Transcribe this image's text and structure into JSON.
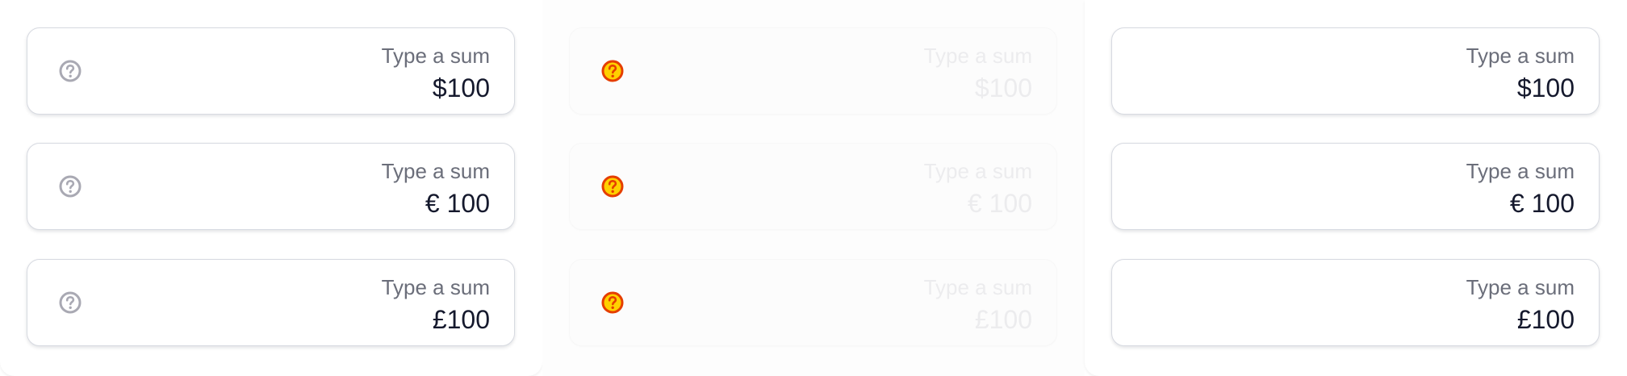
{
  "colors": {
    "help_icon_default": "#a9a9b3",
    "help_icon_error": "#e53e00",
    "help_icon_error_fill": "#ffd000",
    "label_text": "#6b6e7a",
    "value_text": "#15192d",
    "disabled_text": "#ececee",
    "field_border": "#d7dae1"
  },
  "columns": [
    {
      "state": "default",
      "help_icon": "question-circle-icon",
      "fields": [
        {
          "label": "Type a sum",
          "value": "$100"
        },
        {
          "label": "Type a sum",
          "value": "€ 100"
        },
        {
          "label": "Type a sum",
          "value": "£100"
        }
      ]
    },
    {
      "state": "disabled-error",
      "help_icon": "question-circle-icon",
      "fields": [
        {
          "label": "Type a sum",
          "value": "$100"
        },
        {
          "label": "Type a sum",
          "value": "€ 100"
        },
        {
          "label": "Type a sum",
          "value": "£100"
        }
      ]
    },
    {
      "state": "no-icon",
      "fields": [
        {
          "label": "Type a sum",
          "value": "$100"
        },
        {
          "label": "Type a sum",
          "value": "€ 100"
        },
        {
          "label": "Type a sum",
          "value": "£100"
        }
      ]
    }
  ]
}
